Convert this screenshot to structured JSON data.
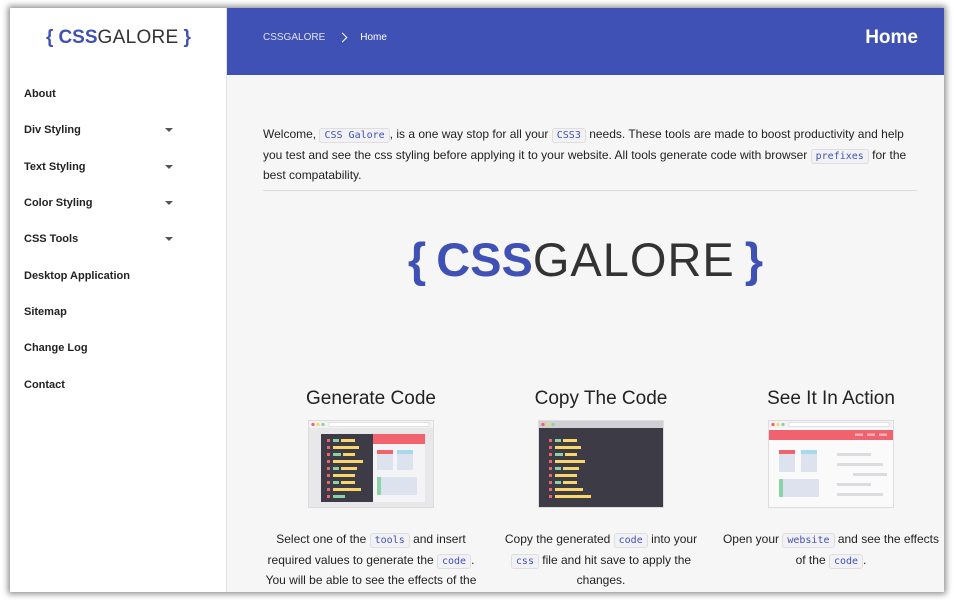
{
  "sidebar": {
    "logo": {
      "brace_open": "{",
      "bold": "CSS",
      "light": "GALORE",
      "brace_close": "}"
    },
    "items": [
      {
        "label": "About",
        "has_dropdown": false
      },
      {
        "label": "Div Styling",
        "has_dropdown": true
      },
      {
        "label": "Text Styling",
        "has_dropdown": true
      },
      {
        "label": "Color Styling",
        "has_dropdown": true
      },
      {
        "label": "CSS Tools",
        "has_dropdown": true
      },
      {
        "label": "Desktop Application",
        "has_dropdown": false
      },
      {
        "label": "Sitemap",
        "has_dropdown": false
      },
      {
        "label": "Change Log",
        "has_dropdown": false
      },
      {
        "label": "Contact",
        "has_dropdown": false
      }
    ]
  },
  "header": {
    "breadcrumb": [
      "CSSGALORE",
      "Home"
    ],
    "title": "Home"
  },
  "main": {
    "intro": {
      "t1": "Welcome, ",
      "c1": "CSS Galore",
      "t2": ", is a one way stop for all your ",
      "c2": "CSS3",
      "t3": " needs. These tools are made to boost productivity and help you test and see the css styling before applying it to your website. All tools generate code with browser ",
      "c3": "prefixes",
      "t4": " for the best compatability."
    },
    "big_logo": {
      "brace_open": "{",
      "bold": "CSS",
      "light": "GALORE",
      "brace_close": "}"
    },
    "cards": [
      {
        "title": "Generate Code",
        "t1": "Select one of the ",
        "c1": "tools",
        "t2": " and insert required values to generate the ",
        "c2": "code",
        "t3": ". You will be able to see the effects of the generated code on the page."
      },
      {
        "title": "Copy The Code",
        "t1": "Copy the generated ",
        "c1": "code",
        "t2": " into your ",
        "c2": "css",
        "t3": " file and hit save to apply the changes."
      },
      {
        "title": "See It In Action",
        "t1": "Open your ",
        "c1": "website",
        "t2": " and see the effects of the ",
        "c2": "code",
        "t3": "."
      }
    ]
  },
  "colors": {
    "brand": "#3f51b5",
    "sidebar_bg": "#ffffff",
    "content_bg": "#f6f6f6",
    "thumb_dark": "#3d3b45",
    "thumb_red": "#f0636e",
    "thumb_yellow": "#f8d66a",
    "thumb_green": "#8bd3a6",
    "thumb_blue": "#a8d8ea"
  }
}
